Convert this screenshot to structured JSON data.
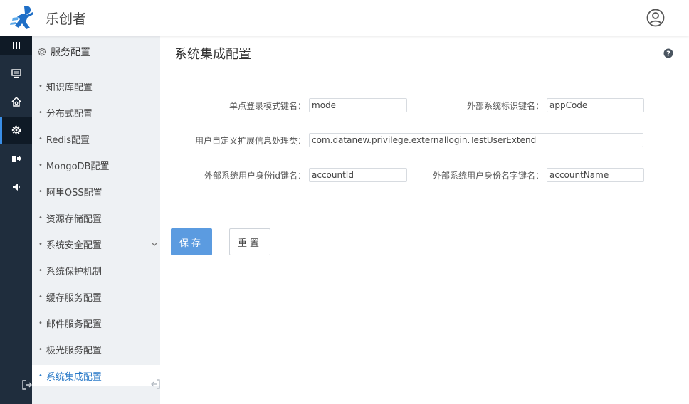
{
  "app": {
    "title": "乐创者"
  },
  "subnav": {
    "title": "服务配置",
    "items": [
      {
        "label": "知识库配置"
      },
      {
        "label": "分布式配置"
      },
      {
        "label": "Redis配置"
      },
      {
        "label": "MongoDB配置"
      },
      {
        "label": "阿里OSS配置"
      },
      {
        "label": "资源存储配置"
      },
      {
        "label": "系统安全配置"
      },
      {
        "label": "系统保护机制"
      },
      {
        "label": "缓存服务配置"
      },
      {
        "label": "邮件服务配置"
      },
      {
        "label": "极光服务配置"
      },
      {
        "label": "系统集成配置"
      }
    ],
    "active_index": 11
  },
  "main": {
    "title": "系统集成配置",
    "form": {
      "sso_key_label": "单点登录模式键名：",
      "sso_key_value": "mode",
      "ext_system_key_label": "外部系统标识键名：",
      "ext_system_key_value": "appCode",
      "user_ext_handler_label": "用户自定义扩展信息处理类：",
      "user_ext_handler_value": "com.datanew.privilege.externallogin.TestUserExtend",
      "ext_user_id_label": "外部系统用户身份id键名：",
      "ext_user_id_value": "accountId",
      "ext_user_name_label": "外部系统用户身份名字键名：",
      "ext_user_name_value": "accountName"
    },
    "save_label": "保存",
    "reset_label": "重置"
  },
  "colors": {
    "rail_bg": "#1f2d3d",
    "accent": "#5b9be0",
    "active_text": "#2d7cc9"
  },
  "icons": {
    "rail": [
      "menu-icon",
      "monitor-icon",
      "home-settings-icon",
      "gear-icon",
      "transfer-icon",
      "volume-icon"
    ],
    "rail_active": "gear-icon"
  }
}
